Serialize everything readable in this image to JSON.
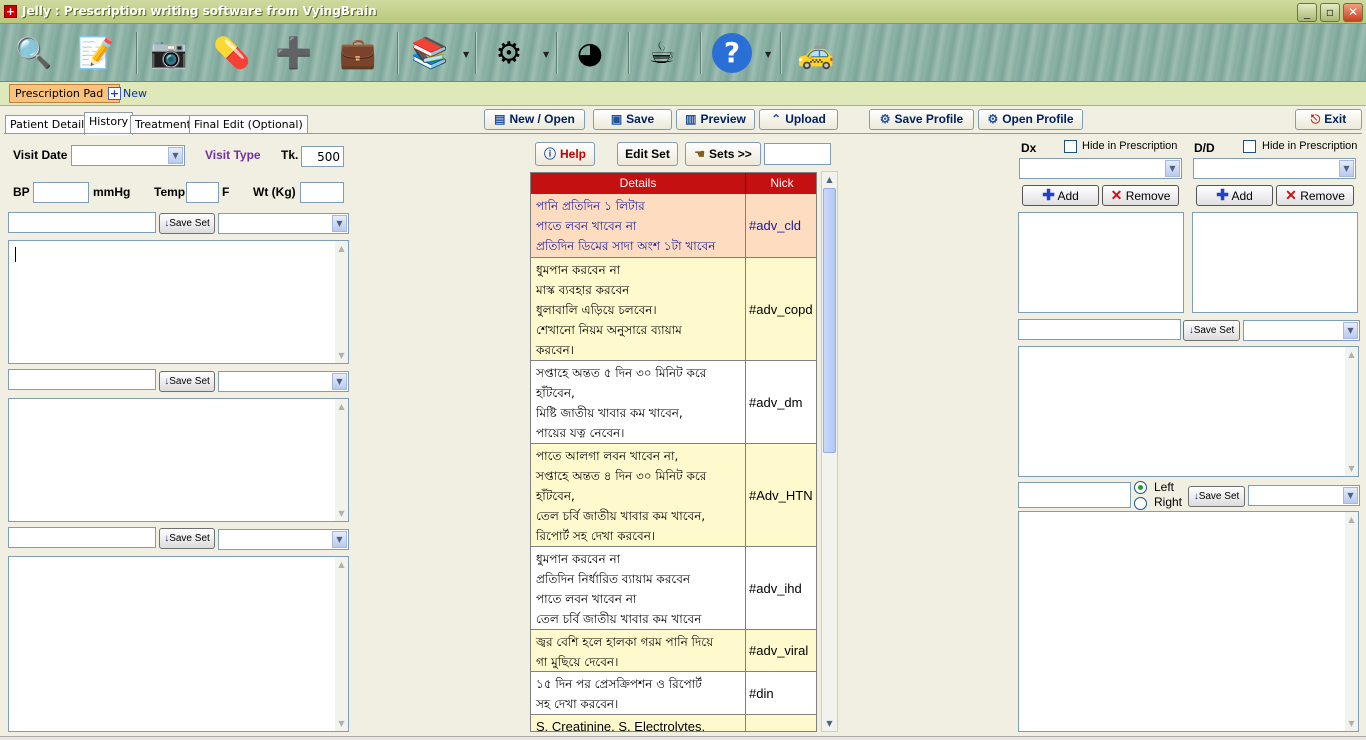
{
  "window": {
    "title": "Jelly : Prescription writing software from VyingBrain",
    "min": "_",
    "max": "▫",
    "close": "✕"
  },
  "toolbar": {
    "icons": [
      "patient-search-icon",
      "notepad-icon",
      "camera-photo-icon",
      "medicine-pills-icon",
      "first-aid-icon",
      "doctor-bag-icon",
      "books-icon",
      "settings-gear-icon",
      "pie-chart-icon",
      "coffee-cup-icon",
      "help-icon",
      "car-icon"
    ]
  },
  "tabstrip": {
    "pad": "Prescription Pad 1",
    "new": "New"
  },
  "tabs": [
    "Patient Details",
    "History",
    "Treatment",
    "Final Edit (Optional)"
  ],
  "actions": {
    "new_open": "New / Open",
    "save": "Save",
    "preview": "Preview",
    "upload": "Upload",
    "save_profile": "Save Profile",
    "open_profile": "Open Profile",
    "exit": "Exit"
  },
  "history": {
    "visit_date_label": "Visit Date",
    "visit_type_label": "Visit Type",
    "tk_label": "Tk.",
    "tk_value": "500",
    "bp_label": "BP",
    "mmhg": "mmHg",
    "temp_label": "Temp",
    "f_label": "F",
    "wt_label": "Wt (Kg)",
    "save_set": "Save Set"
  },
  "center": {
    "help": "Help",
    "edit_set": "Edit Set",
    "sets": "Sets >>"
  },
  "grid": {
    "headers": [
      "Details",
      "Nick"
    ],
    "rows": [
      {
        "details": "পানি প্রতিদিন ১ লিটার\nপাতে লবন খাবেন না\nপ্রতিদিন ডিমের সাদা অংশ ১টা খাবেন",
        "nick": "#adv_cld"
      },
      {
        "details": "ধুমপান করবেন না\nমাস্ক ব্যবহার করবেন\nধুলাবালি এড়িয়ে চলবেন।\nশেখানো নিয়ম অনুসারে ব্যায়াম\nকরবেন।",
        "nick": "#adv_copd"
      },
      {
        "details": "সপ্তাহে অন্তত ৫ দিন ৩০ মিনিট করে\nহাঁটবেন,\nমিষ্টি জাতীয় খাবার কম খাবেন,\nপায়ের যত্ন নেবেন।",
        "nick": "#adv_dm"
      },
      {
        "details": "পাতে আলগা লবন খাবেন না,\nসপ্তাহে অন্তত ৪ দিন ৩০ মিনিট করে\nহাঁটবেন,\nতেল চর্বি জাতীয় খাবার কম খাবেন,\nরিপোর্ট সহ দেখা করবেন।",
        "nick": "#Adv_HTN"
      },
      {
        "details": "ধুমপান করবেন না\nপ্রতিদিন নির্ধারিত ব্যায়াম করবেন\nপাতে লবন খাবেন না\nতেল চর্বি জাতীয় খাবার কম খাবেন",
        "nick": "#adv_ihd"
      },
      {
        "details": "জ্বর বেশি হলে হালকা গরম পানি দিয়ে\nগা মুছিয়ে দেবেন।",
        "nick": "#adv_viral"
      },
      {
        "details": "১৫ দিন পর প্রেসক্রিপশন ও রিপোর্ট\nসহ দেখা করবেন।",
        "nick": "#din"
      },
      {
        "details": "S. Creatinine, S. Electrolytes,",
        "nick": ""
      }
    ]
  },
  "right": {
    "dx_label": "Dx",
    "dd_label": "D/D",
    "hide": "Hide in Prescription",
    "add": "Add",
    "remove": "Remove",
    "save_set": "Save Set",
    "left": "Left",
    "right": "Right"
  },
  "colors": {
    "grid_header": "#c41010",
    "row_selected": "#fddcc0",
    "row_normal": "#fffacd",
    "row_white": "#ffffff",
    "pad_tab": "#fbc27c"
  }
}
